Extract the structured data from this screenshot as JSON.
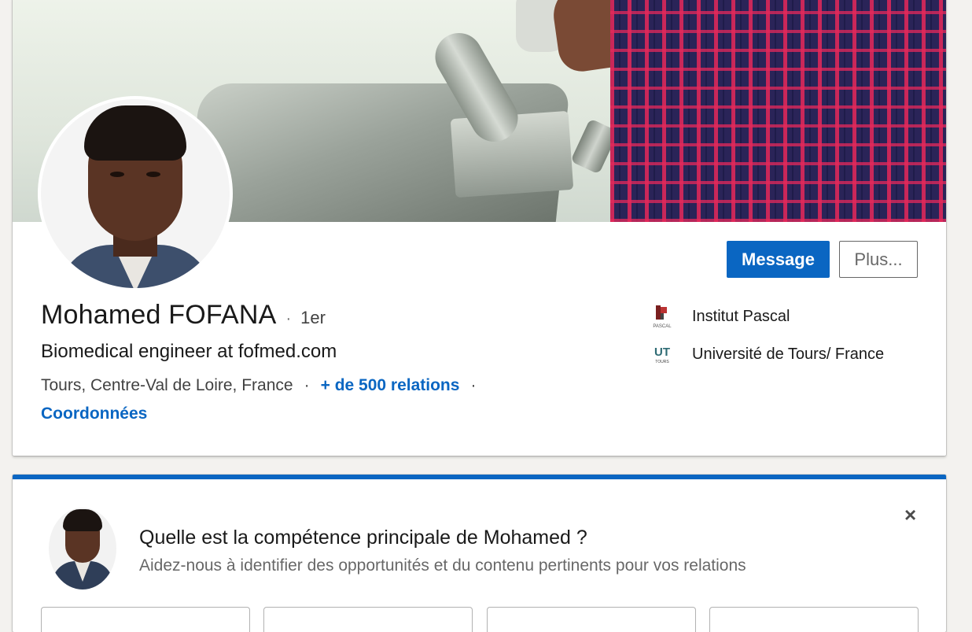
{
  "profile": {
    "name": "Mohamed FOFANA",
    "degree_separator": "·",
    "degree": "1er",
    "headline": "Biomedical engineer at fofmed.com",
    "location": "Tours, Centre-Val de Loire, France",
    "separator": "·",
    "connections": "+ de 500 relations",
    "contact_info": "Coordonnées"
  },
  "actions": {
    "message_label": "Message",
    "more_label": "Plus..."
  },
  "organizations": [
    {
      "name": "Institut Pascal",
      "logo_text": "PASCAL",
      "icon": "institut-pascal-logo"
    },
    {
      "name": "Université de Tours/ France",
      "logo_text": "UT",
      "logo_sub": "TOURS",
      "icon": "universite-tours-logo"
    }
  ],
  "skill_prompt": {
    "title": "Quelle est la compétence principale de Mohamed ?",
    "subtitle": "Aidez-nous à identifier des opportunités et du contenu pertinents pour vos relations",
    "close_icon": "×"
  },
  "colors": {
    "accent": "#0a66c2",
    "background": "#f3f2ef"
  }
}
